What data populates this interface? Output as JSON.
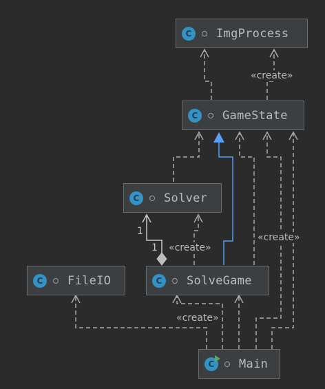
{
  "classes": {
    "imgprocess": {
      "name": "ImgProcess",
      "badge": "C"
    },
    "gamestate": {
      "name": "GameState",
      "badge": "C"
    },
    "solver": {
      "name": "Solver",
      "badge": "C"
    },
    "fileio": {
      "name": "FileIO",
      "badge": "C"
    },
    "solvegame": {
      "name": "SolveGame",
      "badge": "C"
    },
    "main": {
      "name": "Main",
      "badge": "C"
    }
  },
  "labels": {
    "create_gamestate_imgprocess": "«create»",
    "create_solvegame_solver": "«create»",
    "create_solvegame_gamestate": "«create»",
    "create_main_solvegame": "«create»",
    "mult_solver": "1",
    "mult_solvegame": "1"
  },
  "colors": {
    "background": "#2b2b2b",
    "node": "#3c3f41",
    "edge": "#a9a9a9",
    "inheritance": "#589df6",
    "badge": "#3592c4"
  },
  "icons": {
    "class": "class-icon",
    "main": "runnable-class-icon",
    "visibility": "package-visibility-icon"
  }
}
